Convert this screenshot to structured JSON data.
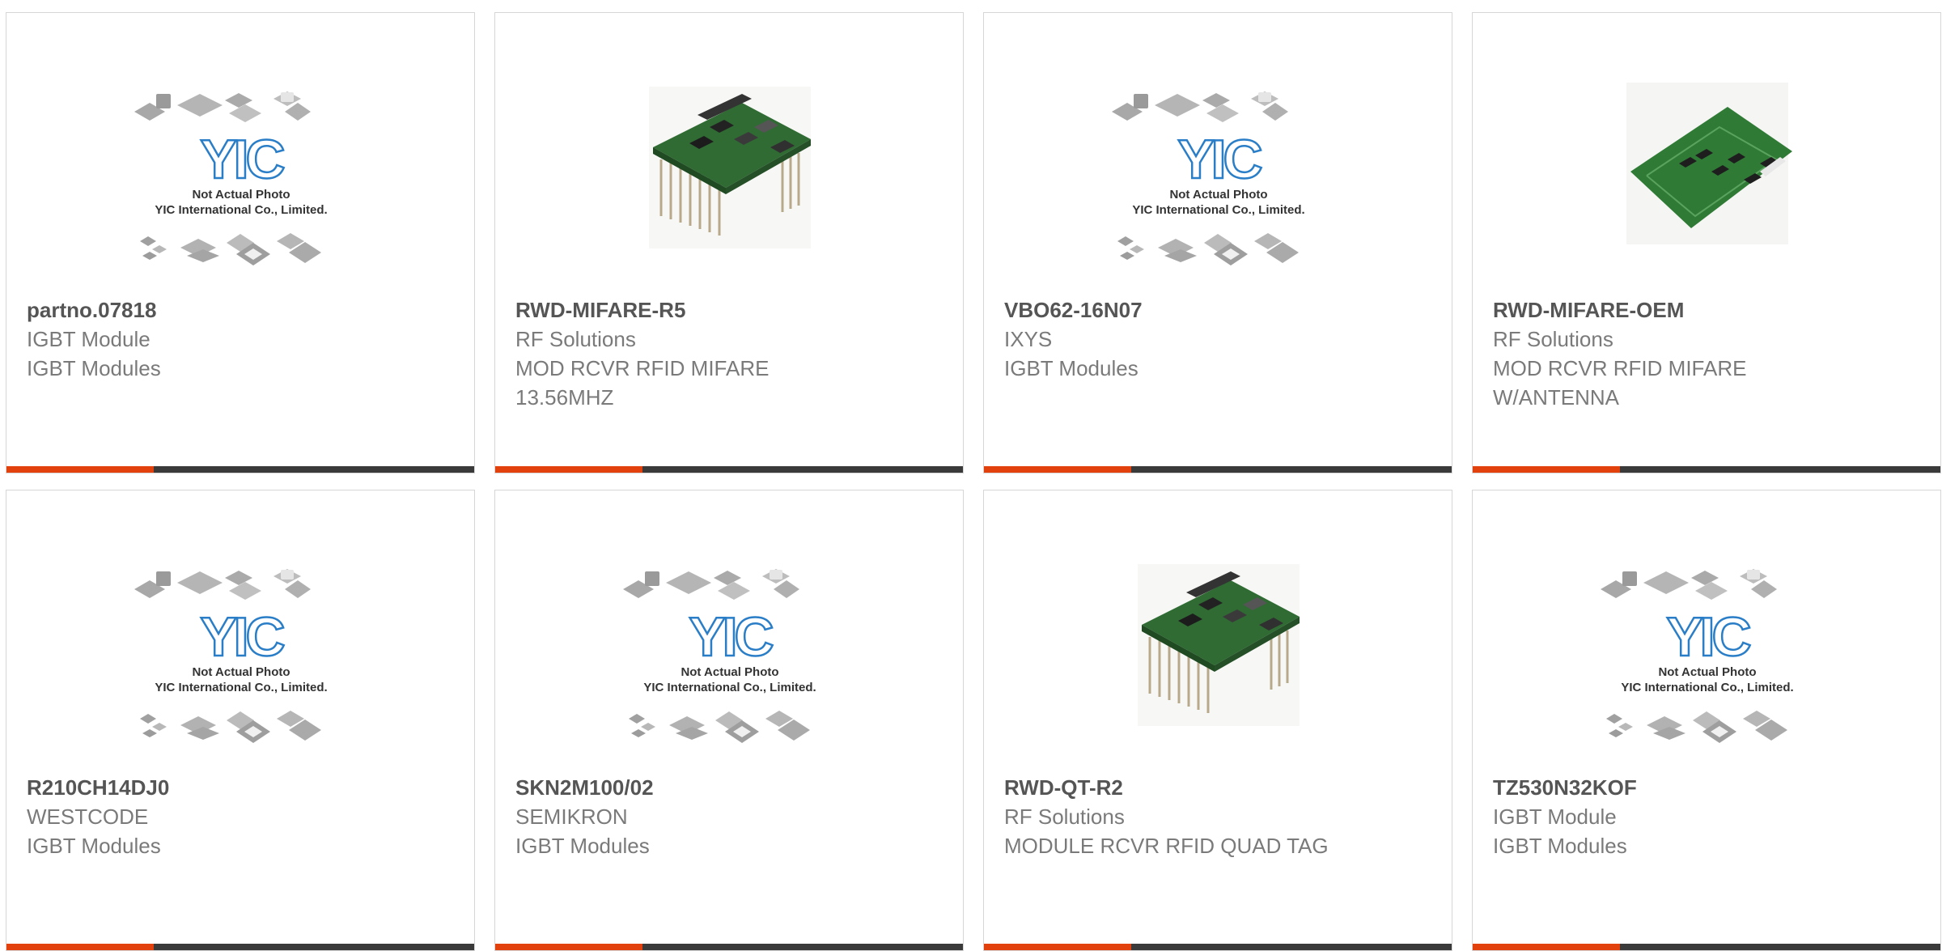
{
  "colors": {
    "accent": "#e2400c",
    "bar": "#3a3a3a",
    "border": "#d6d6d6",
    "part_number": "#555555",
    "meta_text": "#7a7a7a",
    "yic_logo": "#2a7ec7"
  },
  "placeholder": {
    "line1": "Not Actual Photo",
    "line2": "YIC International Co., Limited.",
    "logo": "YIC"
  },
  "products": [
    {
      "part_number": "partno.07818",
      "manufacturer": "IGBT Module",
      "description": "IGBT Modules",
      "image": "placeholder"
    },
    {
      "part_number": "RWD-MIFARE-R5",
      "manufacturer": "RF Solutions",
      "description": "MOD RCVR RFID MIFARE 13.56MHZ",
      "image": "pcb-module-pins"
    },
    {
      "part_number": "VBO62-16N07",
      "manufacturer": "IXYS",
      "description": "IGBT Modules",
      "image": "placeholder"
    },
    {
      "part_number": "RWD-MIFARE-OEM",
      "manufacturer": "RF Solutions",
      "description": "MOD RCVR RFID MIFARE W/ANTENNA",
      "image": "pcb-board"
    },
    {
      "part_number": "R210CH14DJ0",
      "manufacturer": "WESTCODE",
      "description": "IGBT Modules",
      "image": "placeholder"
    },
    {
      "part_number": "SKN2M100/02",
      "manufacturer": "SEMIKRON",
      "description": "IGBT Modules",
      "image": "placeholder"
    },
    {
      "part_number": "RWD-QT-R2",
      "manufacturer": "RF Solutions",
      "description": "MODULE RCVR RFID QUAD TAG",
      "image": "pcb-module-pins"
    },
    {
      "part_number": "TZ530N32KOF",
      "manufacturer": "IGBT Module",
      "description": "IGBT Modules",
      "image": "placeholder"
    }
  ]
}
